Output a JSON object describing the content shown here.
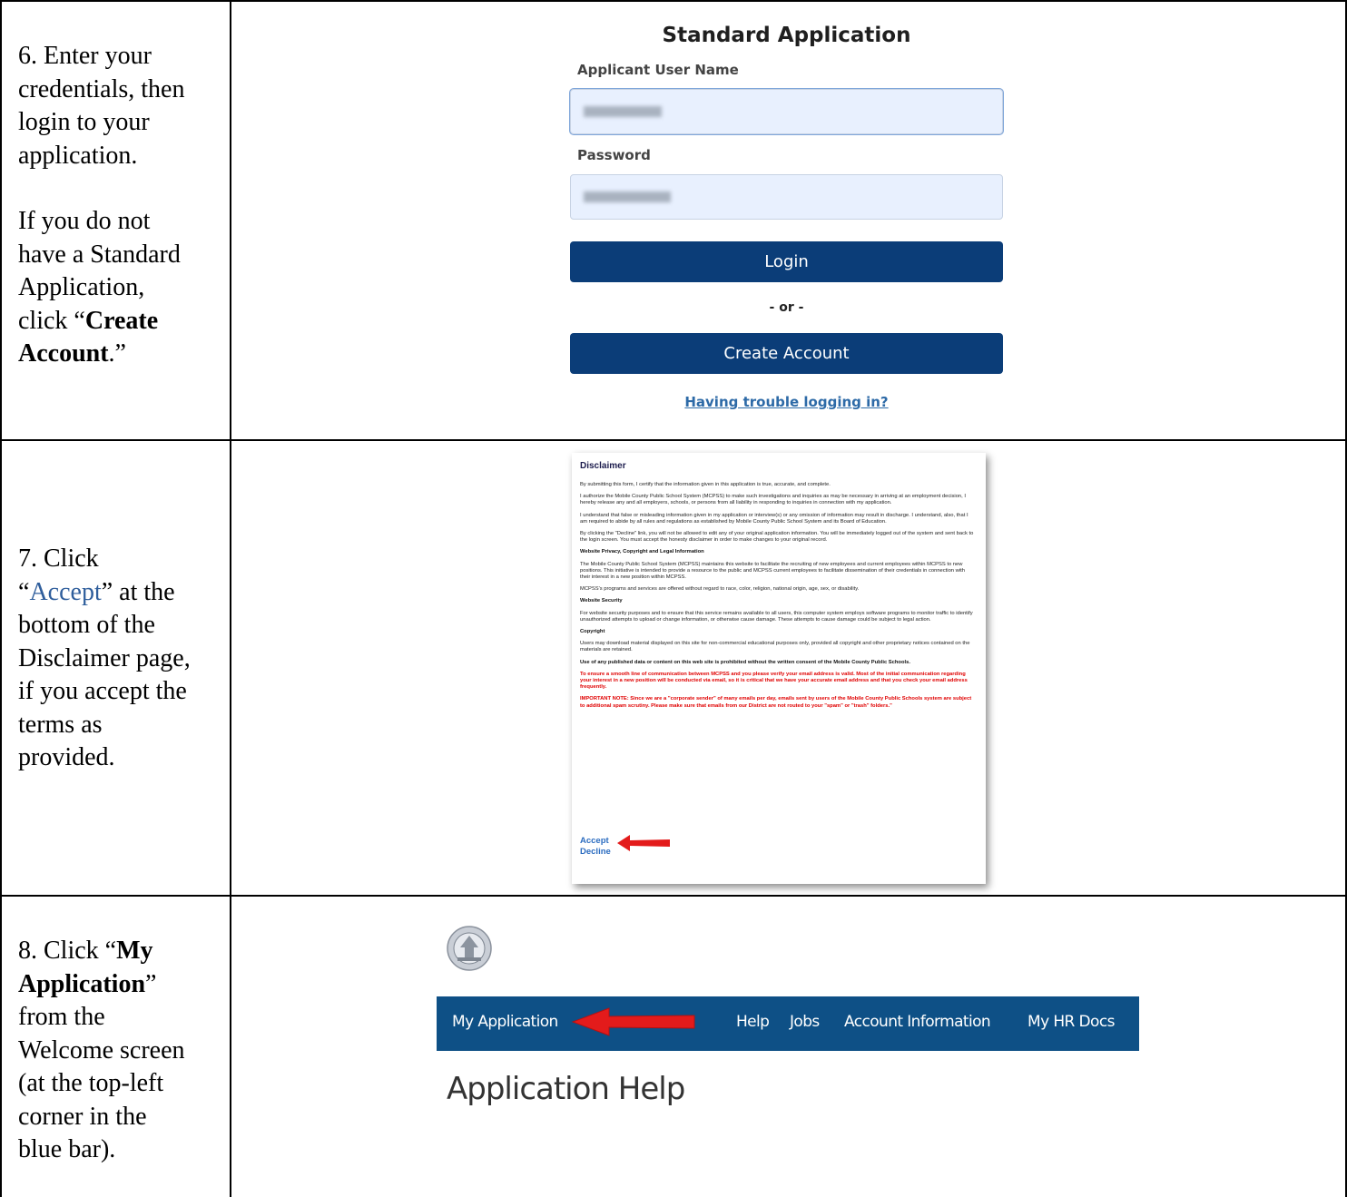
{
  "steps": [
    {
      "instruction_lines": [
        "6. Enter your",
        "credentials, then",
        "login to your",
        "application."
      ],
      "instruction_lines_2": [
        "If you do not",
        "have a Standard",
        "Application,"
      ],
      "click_prefix": "click “",
      "create_bold_1": "Create",
      "create_bold_2": "Account",
      "create_suffix": ".”"
    },
    {
      "line1": "7. Click",
      "quote_open": "“",
      "accept_link": "Accept",
      "quote_close": "” at the",
      "rest_lines": [
        "bottom of the",
        "Disclaimer page,",
        "if you accept the",
        "terms as",
        "provided."
      ]
    },
    {
      "prefix": "8. Click “",
      "bold_1": "My",
      "bold_2": "Application",
      "close": "”",
      "rest_lines": [
        "from the",
        "Welcome screen",
        "(at the top-left",
        "corner in the",
        "blue bar)."
      ]
    }
  ],
  "login_form": {
    "title": "Standard Application",
    "username_label": "Applicant User Name",
    "password_label": "Password",
    "login_button": "Login",
    "or_text": "- or -",
    "create_account_button": "Create Account",
    "trouble_link": "Having trouble logging in?"
  },
  "disclaimer": {
    "title": "Disclaimer",
    "paragraphs": [
      "By submitting this form, I certify that the information given in this application is true, accurate, and complete.",
      "I authorize the Mobile County Public School System (MCPSS) to make such investigations and inquiries as may be necessary in arriving at an employment decision, I hereby release any and all employers, schools, or persons from all liability in responding to inquiries in connection with my application.",
      "I understand that false or misleading information given in my application or interview(s) or any omission of information may result in discharge. I understand, also, that I am required to abide by all rules and regulations as established by Mobile County Public School System and its Board of Education.",
      "By clicking the \"Decline\" link, you will not be allowed to edit any of your original application information. You will be immediately logged out of the system and sent back to the login screen. You must accept the honesty disclaimer in order to make changes to your original record."
    ],
    "privacy_heading": "Website Privacy, Copyright and Legal Information",
    "privacy_paragraphs": [
      "The Mobile County Public School System (MCPSS) maintains this website to facilitate the recruiting of new employees and current employees within MCPSS to new positions. This initiative is intended to provide a resource to the public and MCPSS current employees to facilitate dissemination of their credentials in connection with their interest in a new position within MCPSS.",
      "MCPSS's programs and services are offered without regard to race, color, religion, national origin, age, sex, or disability."
    ],
    "security_heading": "Website Security",
    "security_paragraph": "For website security purposes and to ensure that this service remains available to all users, this computer system employs software programs to monitor traffic to identify unauthorized attempts to upload or change information, or otherwise cause damage. These attempts to cause damage could be subject to legal action.",
    "copyright_heading": "Copyright",
    "copyright_paragraph": "Users may download material displayed on this site for non-commercial educational purposes only, provided all copyright and other proprietary notices contained on the materials are retained.",
    "consent_bold": "Use of any published data or content on this web site is prohibited without the written consent of the Mobile County Public Schools.",
    "red_1": "To ensure a smooth line of communication between MCPSS and you please verify your email address is valid. Most of the initial communication regarding your interest in a new position will be conducted via email, so it is critical that we have your accurate email address and that you check your email address frequently.",
    "red_2": "IMPORTANT NOTE: Since we are a \"corporate sender\" of many emails per day, emails sent by users of the Mobile County Public Schools system are subject to additional spam scrutiny. Please make sure that emails from our District are not routed to your \"spam\" or \"trash\" folders.\"",
    "accept_link": "Accept",
    "decline_link": "Decline"
  },
  "navbar": {
    "my_application": "My Application",
    "help": "Help",
    "jobs": "Jobs",
    "account_information": "Account Information",
    "my_hr_docs": "My HR Docs"
  },
  "page_heading": "Application Help",
  "colors": {
    "nav_blue": "#0e5086",
    "button_blue": "#0b3d78",
    "arrow_red": "#e31b1b",
    "disclaimer_red": "#e00000",
    "link_blue": "#2d6aa7"
  }
}
